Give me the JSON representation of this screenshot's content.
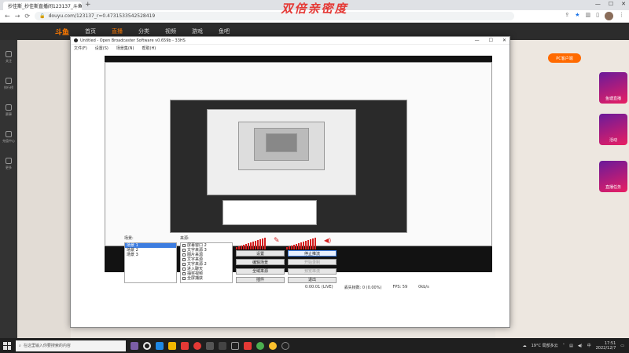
{
  "browser": {
    "tab_title": "抄佳斯_抄佳斯直播间123137_斗鱼",
    "tab_close": "×",
    "new_tab": "+",
    "window_controls": [
      "—",
      "☐",
      "✕"
    ],
    "url": "douyu.com/123137_r=0.4731533542528419",
    "nav": {
      "back": "←",
      "forward": "→",
      "reload": "⟳"
    }
  },
  "caption": "双倍亲密度",
  "site": {
    "logo": "斗鱼",
    "nav_items": [
      "首页",
      "直播",
      "分类",
      "视频",
      "游戏",
      "鱼吧"
    ],
    "active_nav": "直播",
    "sidebar": [
      "关注",
      "排行榜",
      "赛事",
      "充值中心",
      "更多"
    ],
    "pc_button": "PC客户端",
    "posters": [
      "鱼塘直播",
      "活动",
      "直播任务"
    ]
  },
  "obs": {
    "title": "Untitled - Open Broadcaster Software v0.659b - 33HS",
    "menu": [
      "文件(F)",
      "设置(S)",
      "场景集(N)",
      "帮助(H)"
    ],
    "scenes_header": "场景:",
    "scenes": [
      "场景 1",
      "场景 2",
      "场景 3"
    ],
    "selected_scene": 0,
    "sources_header": "来源:",
    "sources": [
      "屏幕窗口 2",
      "文字来源 3",
      "图片来源",
      "文字来源",
      "文字来源 2",
      "进入聊天",
      "抽奖视频",
      "全屏捕获"
    ],
    "controls": [
      {
        "label": "设置",
        "style": "normal"
      },
      {
        "label": "停止推流",
        "style": "blue"
      },
      {
        "label": "编辑场景",
        "style": "normal"
      },
      {
        "label": "开始录制",
        "style": "dis"
      },
      {
        "label": "全域来源",
        "style": "normal"
      },
      {
        "label": "预览串流",
        "style": "dis"
      },
      {
        "label": "插件",
        "style": "normal"
      },
      {
        "label": "退出",
        "style": "normal"
      }
    ],
    "status": [
      "0:00:01 (LIVE)",
      "丢失帧数: 0 (0.00%)",
      "FPS: 59",
      "0kb/s"
    ]
  },
  "taskbar": {
    "search_placeholder": "在这里输入你要搜索的内容",
    "weather": "19°C 局部多云",
    "time": "17:51",
    "date": "2022/12/7"
  },
  "colors": {
    "accent": "#ff6a00",
    "caption": "#e53935",
    "meter": "#d31f1f",
    "selected": "#3d7de0"
  }
}
